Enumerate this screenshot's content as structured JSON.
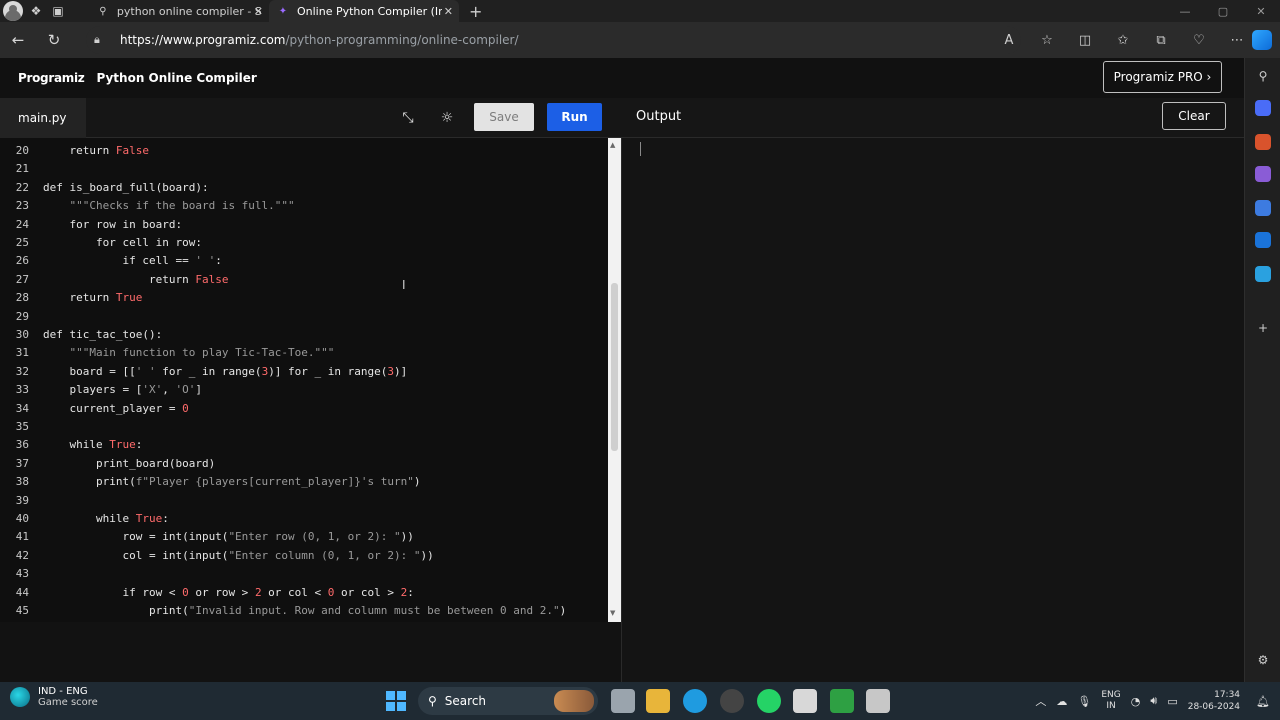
{
  "browser": {
    "tabs": [
      {
        "title": "python online compiler - Search",
        "active": false
      },
      {
        "title": "Online Python Compiler (Interpreter)",
        "active": true
      }
    ],
    "url_host": "https://www.programiz.com",
    "url_path": "/python-programming/online-compiler/"
  },
  "header": {
    "logo": "Programiz",
    "title": "Python Online Compiler",
    "pro_button": "Programiz PRO ›"
  },
  "toolbar": {
    "file_tab": "main.py",
    "save": "Save",
    "run": "Run",
    "output_label": "Output",
    "clear": "Clear"
  },
  "editor": {
    "lines": [
      {
        "n": "20",
        "code": "    return False"
      },
      {
        "n": "21",
        "code": ""
      },
      {
        "n": "22",
        "code": "def is_board_full(board):"
      },
      {
        "n": "23",
        "code": "    \"\"\"Checks if the board is full.\"\"\""
      },
      {
        "n": "24",
        "code": "    for row in board:"
      },
      {
        "n": "25",
        "code": "        for cell in row:"
      },
      {
        "n": "26",
        "code": "            if cell == ' ':"
      },
      {
        "n": "27",
        "code": "                return False"
      },
      {
        "n": "28",
        "code": "    return True"
      },
      {
        "n": "29",
        "code": ""
      },
      {
        "n": "30",
        "code": "def tic_tac_toe():"
      },
      {
        "n": "31",
        "code": "    \"\"\"Main function to play Tic-Tac-Toe.\"\"\""
      },
      {
        "n": "32",
        "code": "    board = [[' ' for _ in range(3)] for _ in range(3)]"
      },
      {
        "n": "33",
        "code": "    players = ['X', 'O']"
      },
      {
        "n": "34",
        "code": "    current_player = 0"
      },
      {
        "n": "35",
        "code": ""
      },
      {
        "n": "36",
        "code": "    while True:"
      },
      {
        "n": "37",
        "code": "        print_board(board)"
      },
      {
        "n": "38",
        "code": "        print(f\"Player {players[current_player]}'s turn\")"
      },
      {
        "n": "39",
        "code": ""
      },
      {
        "n": "40",
        "code": "        while True:"
      },
      {
        "n": "41",
        "code": "            row = int(input(\"Enter row (0, 1, or 2): \"))"
      },
      {
        "n": "42",
        "code": "            col = int(input(\"Enter column (0, 1, or 2): \"))"
      },
      {
        "n": "43",
        "code": ""
      },
      {
        "n": "44",
        "code": "            if row < 0 or row > 2 or col < 0 or col > 2:"
      },
      {
        "n": "45",
        "code": "                print(\"Invalid input. Row and column must be between 0 and 2.\")"
      }
    ]
  },
  "taskbar": {
    "weather_line1": "IND - ENG",
    "weather_line2": "Game score",
    "search": "Search",
    "lang_line1": "ENG",
    "lang_line2": "IN",
    "time": "17:34",
    "date": "28-06-2024"
  },
  "colors": {
    "run_button": "#1c5fe6",
    "keyword_literal": "#ff6b6b",
    "editor_bg": "#0f0f0f"
  }
}
